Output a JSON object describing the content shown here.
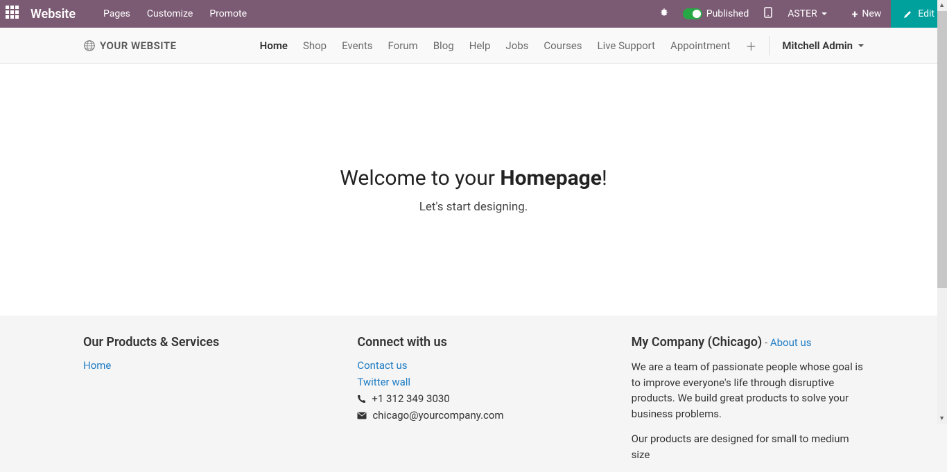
{
  "topbar": {
    "brand": "Website",
    "links": [
      "Pages",
      "Customize",
      "Promote"
    ],
    "published": "Published",
    "site": "ASTER",
    "new_label": "New",
    "edit_label": "Edit"
  },
  "subnav": {
    "logo_text": "YOUR WEBSITE",
    "items": [
      "Home",
      "Shop",
      "Events",
      "Forum",
      "Blog",
      "Help",
      "Jobs",
      "Courses",
      "Live Support",
      "Appointment"
    ],
    "active_index": 0,
    "user": "Mitchell Admin"
  },
  "hero": {
    "title_pre": "Welcome to your ",
    "title_strong": "Homepage",
    "title_post": "!",
    "subtitle": "Let's start designing."
  },
  "footer": {
    "col1": {
      "heading": "Our Products & Services",
      "links": [
        "Home"
      ]
    },
    "col2": {
      "heading": "Connect with us",
      "links": [
        "Contact us",
        "Twitter wall"
      ],
      "phone": "+1 312 349 3030",
      "email": "chicago@yourcompany.com"
    },
    "col3": {
      "heading": "My Company (Chicago)",
      "sep": " - ",
      "about": "About us",
      "p1": "We are a team of passionate people whose goal is to improve everyone's life through disruptive products. We build great products to solve your business problems.",
      "p2": "Our products are designed for small to medium size"
    }
  }
}
